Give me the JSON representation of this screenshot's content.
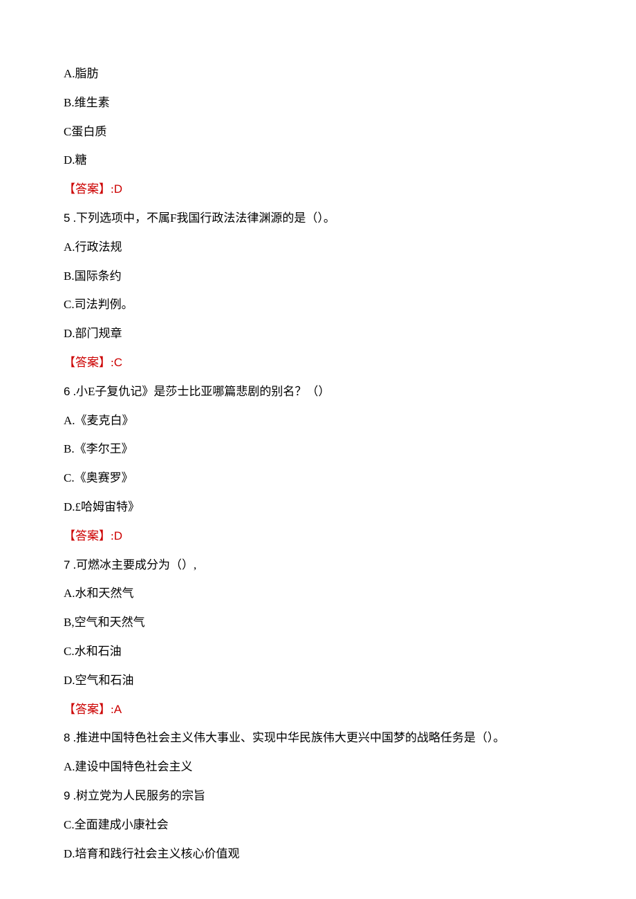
{
  "q4": {
    "options": {
      "a": "A.脂肪",
      "b": "B.维生素",
      "c": "C蛋白质",
      "d": "D.糖"
    },
    "answer_label": "【答案】:",
    "answer_value": "D"
  },
  "q5": {
    "num": "5",
    "text": " .下列选项中，不属F我国行政法法律渊源的是（）。",
    "options": {
      "a": "A.行政法规",
      "b": "B.国际条约",
      "c": "C.司法判例。",
      "d": "D.部门规章"
    },
    "answer_label": "【答案】:",
    "answer_value": "C"
  },
  "q6": {
    "num": "6",
    "text": " .小E子复仇记》是莎士比亚哪篇悲剧的别名？（）",
    "options": {
      "a": "A.《麦克白》",
      "b": "B.《李尔王》",
      "c": "C.《奥赛罗》",
      "d": "D.£哈姆宙特》"
    },
    "answer_label": "【答案】:",
    "answer_value": "D"
  },
  "q7": {
    "num": "7",
    "text": " .可燃冰主要成分为（）,",
    "options": {
      "a": "A.水和天然气",
      "b": "B,空气和天然气",
      "c": "C.水和石油",
      "d": "D.空气和石油"
    },
    "answer_label": "【答案】:",
    "answer_value": "A"
  },
  "q8": {
    "num": "8",
    "text": "  .推进中国特色社会主义伟大事业、实现中华民族伟大更兴中国梦的战略任务是（）。",
    "options": {
      "a": "A.建设中国特色社会主义"
    }
  },
  "q9": {
    "num": "9",
    "text": " .树立党为人民服务的宗旨",
    "options": {
      "c": "C.全面建成小康社会",
      "d": "D.培育和践行社会主义核心价值观"
    }
  }
}
